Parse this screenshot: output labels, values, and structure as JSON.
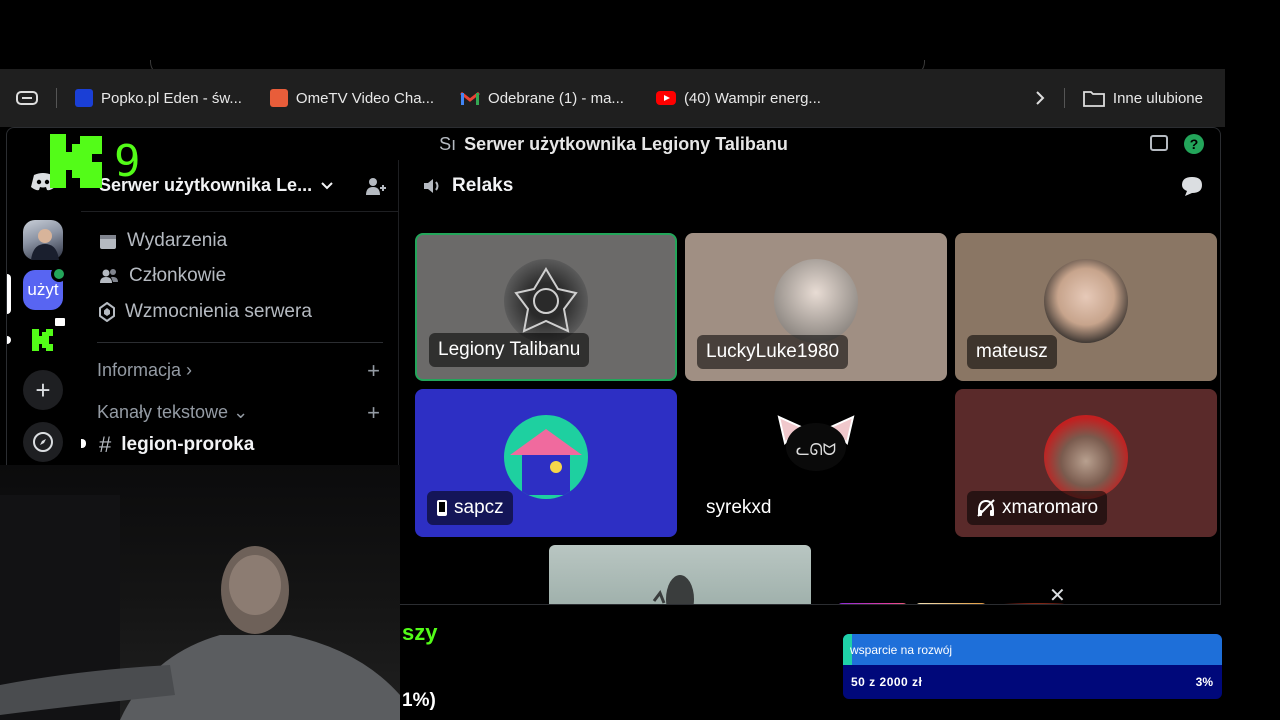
{
  "overlay": {
    "stream_logo": "9"
  },
  "browser": {
    "bookmarks": [
      {
        "label": "Popko.pl Eden - św...",
        "icon": "popko-favicon",
        "color": "#1a3fd6"
      },
      {
        "label": "OmeTV Video Cha...",
        "icon": "ometv-favicon",
        "color": "#e85d3a"
      },
      {
        "label": "Odebrane (1) - ma...",
        "icon": "gmail-favicon",
        "color": "#d93025"
      },
      {
        "label": "(40) Wampir energ...",
        "icon": "youtube-favicon",
        "color": "#ff0000"
      }
    ],
    "other_bookmarks": "Inne ulubione"
  },
  "discord": {
    "window_title_prefix": "Sı",
    "window_title": "Serwer użytkownika Legiony Talibanu",
    "server_name": "Serwer użytkownika Le...",
    "nav": [
      {
        "label": "Wydarzenia",
        "icon": "calendar-icon"
      },
      {
        "label": "Członkowie",
        "icon": "members-icon"
      },
      {
        "label": "Wzmocnienia serwera",
        "icon": "boost-icon"
      }
    ],
    "categories": {
      "info": "Informacja ›",
      "text": "Kanały tekstowe ⌄"
    },
    "active_channel": "legion-proroka",
    "guild_label": "użyt",
    "voice_channel": "Relaks",
    "participants": [
      {
        "name": "Legiony Talibanu",
        "speaking": true,
        "bg": "#6b6a69"
      },
      {
        "name": "LuckyLuke1980",
        "bg": "#a08f83"
      },
      {
        "name": "mateusz",
        "bg": "#8a7664"
      },
      {
        "name": "sapcz",
        "device": "phone-icon",
        "bg": "#2d2fc4"
      },
      {
        "name": "syrekxd",
        "bg": "#000000"
      },
      {
        "name": "xmaromaro",
        "status": "deafened-icon",
        "bg": "#5a2a2a"
      }
    ],
    "close_glyph": "✕"
  },
  "stream": {
    "partial_text_1": "szy",
    "partial_text_2": "1%)",
    "donation_goal": {
      "label": "wsparcie na rozwój",
      "progress": "50 z 2000 zł",
      "percent": "3%",
      "fraction": 0.025
    }
  }
}
